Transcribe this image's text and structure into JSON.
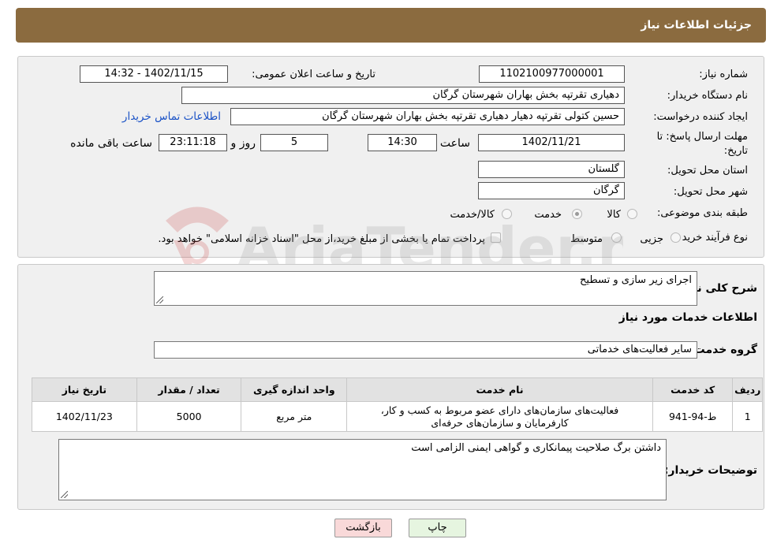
{
  "header": {
    "title": "جزئیات اطلاعات نیاز"
  },
  "form": {
    "need_number": {
      "label": "شماره نیاز:",
      "value": "1102100977000001"
    },
    "announce_datetime": {
      "label": "تاریخ و ساعت اعلان عمومی:",
      "value": "1402/11/15 - 14:32"
    },
    "buyer_org": {
      "label": "نام دستگاه خریدار:",
      "value": "دهیاری تقرتپه بخش بهاران شهرستان گرگان"
    },
    "requester": {
      "label": "ایجاد کننده درخواست:",
      "value": "حسین کتولی تقرتپه دهیار دهیاری تقرتپه بخش بهاران شهرستان گرگان"
    },
    "buyer_contact_link": "اطلاعات تماس خریدار",
    "deadline": {
      "label_line1": "مهلت ارسال پاسخ: تا",
      "label_line2": "تاریخ:",
      "date": "1402/11/21",
      "time_label": "ساعت",
      "time": "14:30",
      "days": "5",
      "days_label": "روز و",
      "remaining": "23:11:18",
      "remaining_label": "ساعت باقی مانده"
    },
    "province": {
      "label": "استان محل تحویل:",
      "value": "گلستان"
    },
    "city": {
      "label": "شهر محل تحویل:",
      "value": "گرگان"
    },
    "category": {
      "label": "طبقه بندی موضوعی:",
      "options": [
        {
          "label": "کالا",
          "checked": false
        },
        {
          "label": "خدمت",
          "checked": true
        },
        {
          "label": "کالا/خدمت",
          "checked": false
        }
      ]
    },
    "purchase_type": {
      "label": "نوع فرآیند خرید :",
      "options": [
        {
          "label": "جزیی",
          "checked": false
        },
        {
          "label": "متوسط",
          "checked": false
        }
      ],
      "payment_checkbox_label": "پرداخت تمام یا بخشی از مبلغ خرید،از محل \"اسناد خزانه اسلامی\" خواهد بود.",
      "payment_checked": false
    }
  },
  "details": {
    "summary_label": "شرح کلی نیاز:",
    "summary_value": "اجرای زیر سازی و تسطیح",
    "services_heading": "اطلاعات خدمات مورد نیاز",
    "service_group_label": "گروه خدمت:",
    "service_group_value": "سایر فعالیت‌های خدماتی",
    "table": {
      "headers": [
        "ردیف",
        "کد خدمت",
        "نام خدمت",
        "واحد اندازه گیری",
        "تعداد / مقدار",
        "تاریخ نیاز"
      ],
      "rows": [
        {
          "row": "1",
          "code": "ط-94-941",
          "name_line1": "فعالیت‌های سازمان‌های دارای عضو مربوط به کسب و کار،",
          "name_line2": "کارفرمایان و سازمان‌های حرفه‌ای",
          "unit": "متر مربع",
          "quantity": "5000",
          "need_date": "1402/11/23"
        }
      ]
    },
    "buyer_notes_label": "توضیحات خریدار:",
    "buyer_notes_value": "داشتن برگ صلاحیت پیمانکاری و گواهی ایمنی الزامی است"
  },
  "buttons": {
    "print": "چاپ",
    "back": "بازگشت"
  },
  "watermark": {
    "text": "AriaTender.neT"
  },
  "colors": {
    "header_bg": "#8b6b3f",
    "back_button_bg": "#f9d9d9",
    "print_button_bg": "#e6f5e0",
    "link": "#1a52c6"
  }
}
